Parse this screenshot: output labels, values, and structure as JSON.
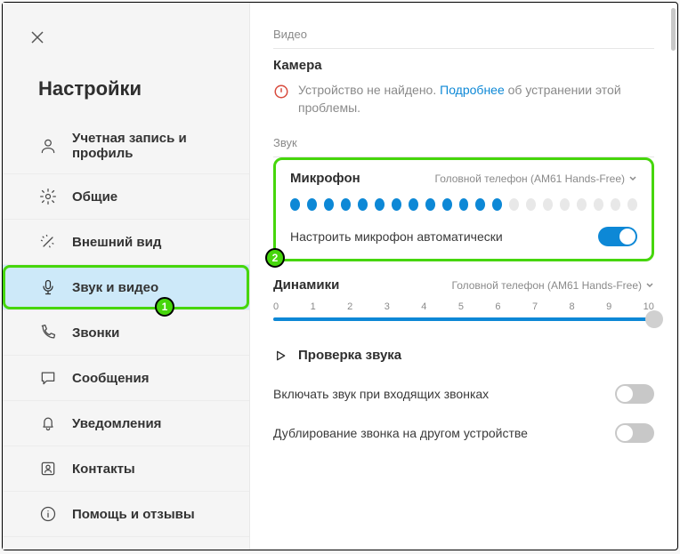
{
  "sidebar": {
    "title": "Настройки",
    "items": [
      {
        "label": "Учетная запись и профиль"
      },
      {
        "label": "Общие"
      },
      {
        "label": "Внешний вид"
      },
      {
        "label": "Звук и видео"
      },
      {
        "label": "Звонки"
      },
      {
        "label": "Сообщения"
      },
      {
        "label": "Уведомления"
      },
      {
        "label": "Контакты"
      },
      {
        "label": "Помощь и отзывы"
      }
    ]
  },
  "video": {
    "section_label": "Видео",
    "camera_title": "Камера",
    "not_found_prefix": "Устройство не найдено. ",
    "learn_more": "Подробнее",
    "not_found_suffix": " об устранении этой проблемы."
  },
  "audio": {
    "section_label": "Звук",
    "mic_title": "Микрофон",
    "mic_device": "Головной телефон (AM61 Hands-Free)",
    "mic_level_active": 13,
    "mic_level_total": 21,
    "auto_adjust_label": "Настроить микрофон автоматически",
    "auto_adjust_on": true,
    "speakers_title": "Динамики",
    "speakers_device": "Головной телефон (AM61 Hands-Free)",
    "slider_ticks": [
      "0",
      "1",
      "2",
      "3",
      "4",
      "5",
      "6",
      "7",
      "8",
      "9",
      "10"
    ],
    "slider_value": 10,
    "test_label": "Проверка звука",
    "opt_incoming_label": "Включать звук при входящих звонках",
    "opt_incoming_on": false,
    "opt_duplicate_label": "Дублирование звонка на другом устройстве",
    "opt_duplicate_on": false
  },
  "callouts": {
    "badge1": "1",
    "badge2": "2"
  }
}
